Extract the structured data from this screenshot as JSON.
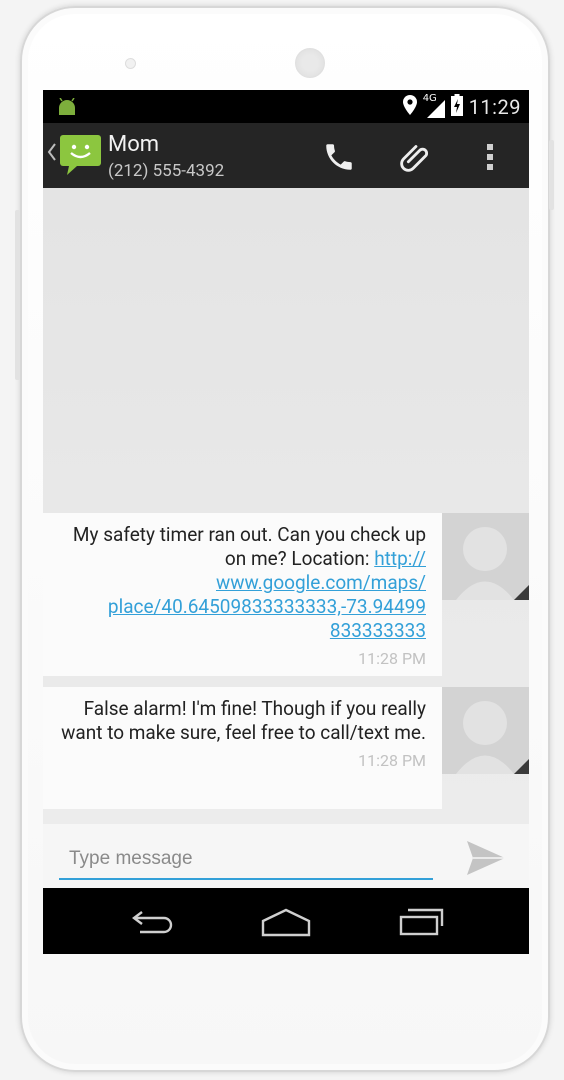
{
  "status_bar": {
    "time": "11:29",
    "network": "4G"
  },
  "conversation": {
    "name": "Mom",
    "number": "(212) 555-4392"
  },
  "messages": [
    {
      "text": "My safety timer ran out. Can you check up on me? Location: ",
      "link": "http://www.google.com/maps/place/40.64509833333333,-73.94499833333333",
      "link_lines": [
        "http://",
        "www.google.com/maps/",
        "place/40.64509833333333,-73.94499",
        "833333333"
      ],
      "time": "11:28 PM"
    },
    {
      "text": "False alarm! I'm fine! Though if you really want to make sure, feel free to call/text me.",
      "time": "11:28 PM"
    }
  ],
  "compose": {
    "placeholder": "Type message",
    "value": ""
  },
  "icons": {
    "back": "chevron-left-icon",
    "contact": "sms-smiley-icon",
    "call": "phone-icon",
    "attach": "paperclip-icon",
    "overflow": "overflow-menu-icon",
    "send": "send-icon",
    "nav_back": "back-arrow-icon",
    "nav_home": "home-icon",
    "nav_recents": "recents-icon"
  },
  "colors": {
    "link": "#33a0d8",
    "action_bar": "#252525",
    "sms_icon": "#8cc63f",
    "bubble": "#fbfbfb"
  }
}
